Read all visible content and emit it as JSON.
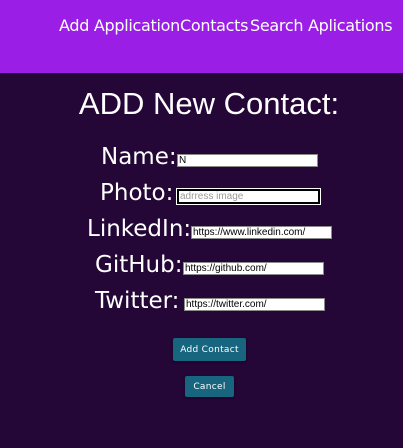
{
  "nav": {
    "add_application": "Add Application",
    "contacts": "Contacts",
    "search_applications": "Search Aplications"
  },
  "page": {
    "title": "ADD New Contact:"
  },
  "form": {
    "name": {
      "label": "Name:",
      "value": "N",
      "placeholder": ""
    },
    "photo": {
      "label": "Photo:",
      "value": "",
      "placeholder": "adrress image"
    },
    "linkedin": {
      "label": "LinkedIn:",
      "value": "https://www.linkedin.com/",
      "placeholder": ""
    },
    "github": {
      "label": "GitHub:",
      "value": "https://github.com/",
      "placeholder": ""
    },
    "twitter": {
      "label": "Twitter:",
      "value": "https://twitter.com/",
      "placeholder": ""
    }
  },
  "actions": {
    "add_contact": "Add Contact",
    "cancel": "Cancel"
  },
  "colors": {
    "background": "#240637",
    "navbar": "#9a1ee6",
    "button": "#17657e"
  }
}
